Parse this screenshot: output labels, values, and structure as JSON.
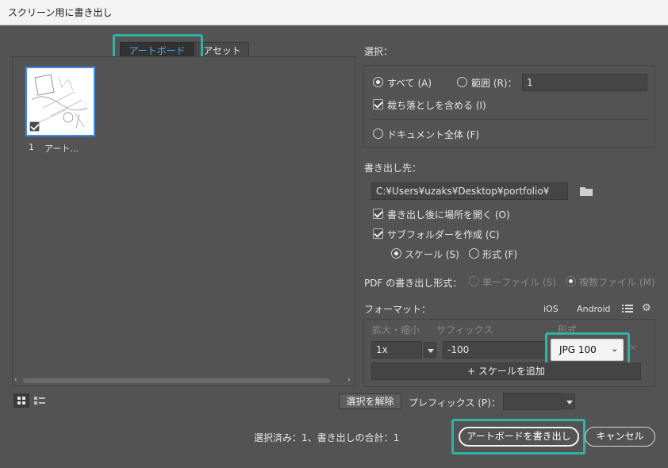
{
  "window": {
    "title": "スクリーン用に書き出し"
  },
  "tabs": {
    "artboard": "アートボード",
    "asset": "アセット"
  },
  "artboard_list": [
    {
      "number": "1",
      "name": "アート..."
    }
  ],
  "selection": {
    "heading": "選択：",
    "all_label": "すべて (A)",
    "range_label": "範囲 (R)：",
    "range_value": "1",
    "bleed_label": "裁ち落としを含める (I)",
    "whole_doc_label": "ドキュメント全体 (F)"
  },
  "export_to": {
    "heading": "書き出し先：",
    "path": "C:¥Users¥uzaks¥Desktop¥portfolio¥",
    "open_after_label": "書き出し後に場所を開く (O)",
    "subfolder_label": "サブフォルダーを作成 (C)",
    "scale_label": "スケール (S)",
    "format_label": "形式 (F)"
  },
  "pdf": {
    "label": "PDF の書き出し形式：",
    "single_label": "単一ファイル (S)",
    "multi_label": "複数ファイル (M)"
  },
  "format": {
    "heading": "フォーマット：",
    "ios": "iOS",
    "android": "Android",
    "col_scale": "拡大・縮小",
    "col_suffix": "サフィックス",
    "col_format": "形式",
    "row_scale": "1x",
    "row_suffix": "-100",
    "row_format": "JPG 100",
    "add_scale": "+ スケールを追加"
  },
  "bottom": {
    "deselect": "選択を解除",
    "prefix_label": "プレフィックス (P)：",
    "prefix_value": "",
    "status": "選択済み：1、書き出しの合計：1",
    "export_button": "アートボードを書き出し",
    "cancel_button": "キャンセル"
  },
  "colors": {
    "highlight": "#2fb3a5",
    "selection_blue": "#3d8ee8"
  }
}
